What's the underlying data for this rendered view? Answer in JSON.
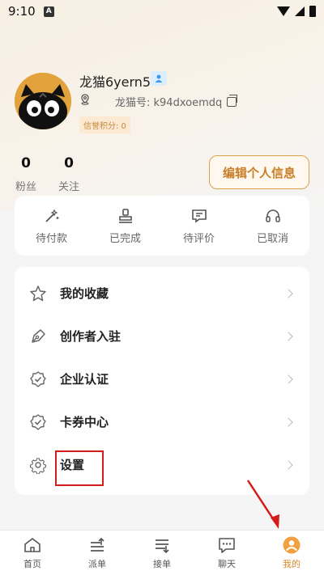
{
  "status_bar": {
    "time": "9:10",
    "notif": "A"
  },
  "profile": {
    "nickname": "龙猫6yern5",
    "uid": "龙猫号: k94dxoemdq",
    "credit": "信誉积分: 0"
  },
  "stats": [
    {
      "num": "0",
      "label": "粉丝"
    },
    {
      "num": "0",
      "label": "关注"
    }
  ],
  "edit_button": "编辑个人信息",
  "orders": [
    {
      "label": "待付款",
      "icon": "wand-icon"
    },
    {
      "label": "已完成",
      "icon": "stamp-icon"
    },
    {
      "label": "待评价",
      "icon": "comment-icon"
    },
    {
      "label": "已取消",
      "icon": "headset-icon"
    }
  ],
  "menu": [
    {
      "label": "我的收藏",
      "icon": "star-icon"
    },
    {
      "label": "创作者入驻",
      "icon": "pen-icon"
    },
    {
      "label": "企业认证",
      "icon": "badge-check-icon"
    },
    {
      "label": "卡券中心",
      "icon": "coupon-icon"
    },
    {
      "label": "设置",
      "icon": "gear-icon"
    }
  ],
  "tabs": [
    {
      "label": "首页",
      "icon": "home-icon"
    },
    {
      "label": "派单",
      "icon": "dispatch-icon"
    },
    {
      "label": "接单",
      "icon": "accept-icon"
    },
    {
      "label": "聊天",
      "icon": "chat-icon"
    },
    {
      "label": "我的",
      "icon": "profile-icon"
    }
  ],
  "colors": {
    "accent": "#d98a2b",
    "highlight": "#d31b1b"
  }
}
